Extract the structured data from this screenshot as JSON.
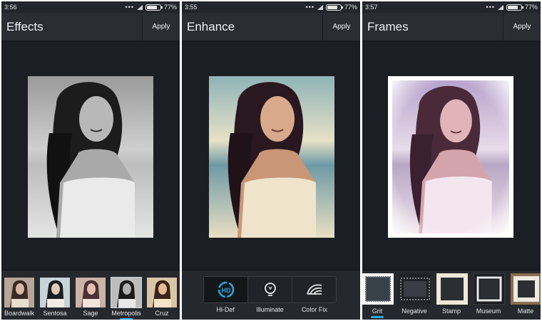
{
  "panels": [
    {
      "time": "3:56",
      "battery": "77%",
      "title": "Effects",
      "apply_label": "Apply",
      "thumbs": [
        {
          "label": "Boardwalk"
        },
        {
          "label": "Sentosa"
        },
        {
          "label": "Sage"
        },
        {
          "label": "Metropolis",
          "active": true
        },
        {
          "label": "Cruz"
        }
      ]
    },
    {
      "time": "3:55",
      "battery": "77%",
      "title": "Enhance",
      "apply_label": "Apply",
      "tools": [
        {
          "label": "Hi-Def",
          "icon": "hd-icon",
          "active": true
        },
        {
          "label": "Illuminate",
          "icon": "bulb-icon"
        },
        {
          "label": "Color Fix",
          "icon": "color-fix-icon"
        }
      ]
    },
    {
      "time": "3:57",
      "battery": "77%",
      "title": "Frames",
      "apply_label": "Apply",
      "frames": [
        {
          "label": "Grit",
          "active": true
        },
        {
          "label": "Negative"
        },
        {
          "label": "Stamp"
        },
        {
          "label": "Museum"
        },
        {
          "label": "Matte"
        }
      ]
    }
  ],
  "colors": {
    "accent": "#2aa8e0",
    "background": "#1a1d21",
    "toolbar": "#2a2e33"
  }
}
